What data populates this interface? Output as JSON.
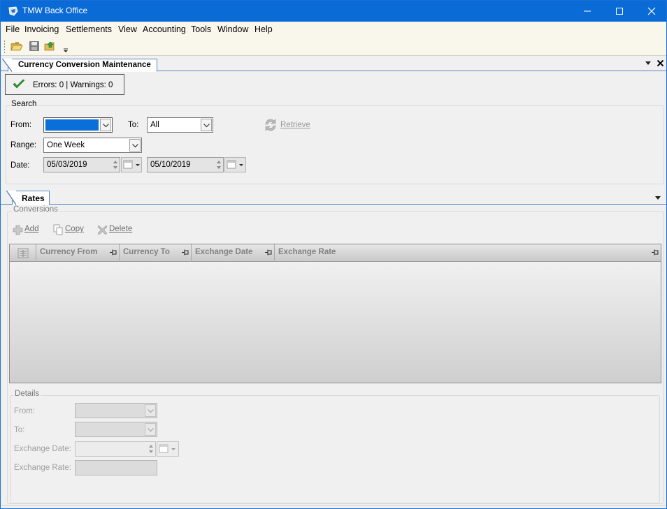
{
  "window": {
    "title": "TMW Back Office"
  },
  "menu": {
    "items": [
      "File",
      "Invoicing",
      "Settlements",
      "View",
      "Accounting",
      "Tools",
      "Window",
      "Help"
    ]
  },
  "toolbar": {
    "icons": [
      "open-folder-icon",
      "save-icon",
      "export-icon"
    ]
  },
  "document_tab": {
    "label": "Currency Conversion Maintenance"
  },
  "status": {
    "text": "Errors: 0 | Warnings: 0"
  },
  "search": {
    "group_label": "Search",
    "from_label": "From:",
    "from_value": "",
    "to_label": "To:",
    "to_value": "All",
    "range_label": "Range:",
    "range_value": "One Week",
    "date_label": "Date:",
    "date_start": "05/03/2019",
    "date_end": "05/10/2019",
    "retrieve_label": "Retrieve"
  },
  "rates_tab": {
    "label": "Rates"
  },
  "conversions": {
    "group_label": "Conversions",
    "add_label": "Add",
    "copy_label": "Copy",
    "delete_label": "Delete",
    "columns": [
      "Currency From",
      "Currency To",
      "Exchange Date",
      "Exchange Rate"
    ],
    "rows": []
  },
  "details": {
    "group_label": "Details",
    "from_label": "From:",
    "to_label": "To:",
    "exchange_date_label": "Exchange Date:",
    "exchange_rate_label": "Exchange Rate:"
  },
  "colors": {
    "titlebar": "#0b6bd6",
    "tab_border": "#5b85c2",
    "selection": "#0a6fd8"
  }
}
